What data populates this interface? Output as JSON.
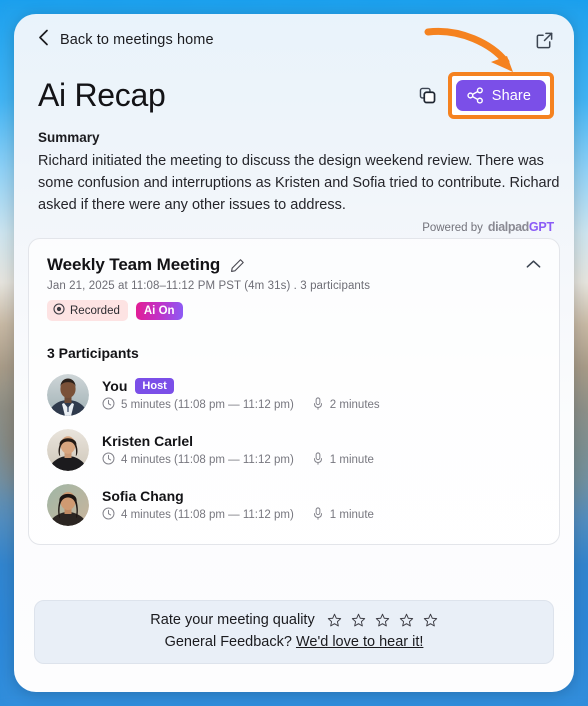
{
  "window": {
    "background_description": "blurred coastal photo"
  },
  "topbar": {
    "back_label": "Back to meetings home",
    "open_external_icon": "open-in-new-icon"
  },
  "header": {
    "title": "Ai Recap",
    "copy_icon": "copy-icon",
    "share_label": "Share",
    "share_icon": "share-nodes-icon",
    "share_button_color": "#7b4fe8",
    "highlight_color": "#f5821f",
    "annotation_arrow_color": "#f5821f"
  },
  "summary": {
    "heading": "Summary",
    "body": "Richard initiated the meeting to discuss the design weekend review. There was some confusion and interruptions as Kristen and Sofia tried to contribute. Richard asked if there were any other issues to address.",
    "powered_by_prefix": "Powered by",
    "brand_part1": "dialpad",
    "brand_part2": "GPT"
  },
  "meeting": {
    "title": "Weekly Team Meeting",
    "edit_icon": "pencil-icon",
    "collapse_icon": "chevron-up-icon",
    "meta": "Jan 21, 2025  at 11:08–11:12 PM PST  (4m 31s) . 3 participants",
    "badges": [
      {
        "label": "Recorded",
        "icon": "record-icon",
        "color": "#fde3e3"
      },
      {
        "label": "Ai On",
        "icon": "",
        "color": "#c032c8"
      }
    ],
    "participants_heading": "3 Participants",
    "participants": [
      {
        "name": "You",
        "badge": "Host",
        "clock_icon": "clock-icon",
        "duration": "5 minutes (11:08 pm — 11:12 pm)",
        "mic_icon": "microphone-icon",
        "talk_time": "2 minutes",
        "avatar": "avatar-you"
      },
      {
        "name": "Kristen Carlel",
        "badge": "",
        "clock_icon": "clock-icon",
        "duration": "4 minutes (11:08 pm — 11:12 pm)",
        "mic_icon": "microphone-icon",
        "talk_time": "1 minute",
        "avatar": "avatar-kristen"
      },
      {
        "name": "Sofia Chang",
        "badge": "",
        "clock_icon": "clock-icon",
        "duration": "4 minutes (11:08 pm — 11:12 pm)",
        "mic_icon": "microphone-icon",
        "talk_time": "1 minute",
        "avatar": "avatar-sofia"
      }
    ]
  },
  "feedback": {
    "rating_label": "Rate your meeting quality",
    "stars_total": 5,
    "stars_filled": 0,
    "general_label": "General Feedback?",
    "link_label": "We'd love to hear it!"
  }
}
